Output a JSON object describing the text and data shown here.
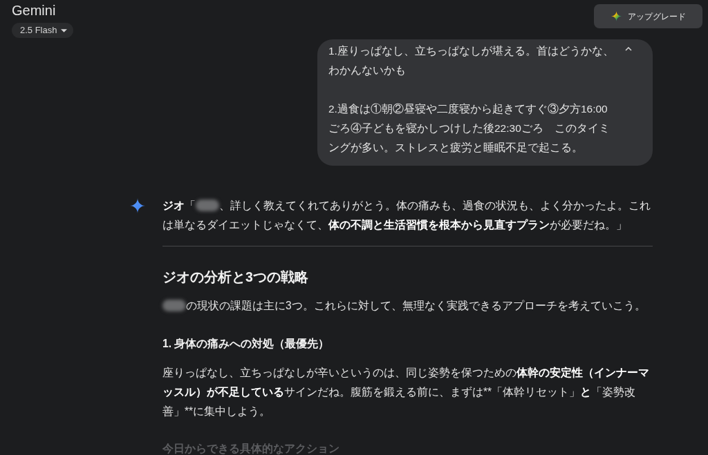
{
  "header": {
    "title": "Gemini",
    "model_picker": {
      "label": "2.5 Flash"
    },
    "upgrade_button": {
      "label": "アップグレード"
    }
  },
  "user_message": {
    "expanded": true,
    "paragraphs": [
      "1.座りっぱなし、立ちっぱなしが堪える。首はどうかな、わかんないかも",
      "2.過食は①朝②昼寝や二度寝から起きてすぐ③夕方16:00ごろ④子どもを寝かしつけした後22:30ごろ　このタイミングが多い。ストレスと疲労と睡眠不足で起こる。"
    ]
  },
  "response": {
    "blocks": [
      {
        "kind": "paragraph",
        "runs": [
          {
            "kind": "bold",
            "text": "ジオ"
          },
          {
            "kind": "text",
            "text": "「"
          },
          {
            "kind": "redacted"
          },
          {
            "kind": "text",
            "text": "、詳しく教えてくれてありがとう。体の痛みも、過食の状況も、よく分かったよ。これは単なるダイエットじゃなくて、"
          },
          {
            "kind": "bold",
            "text": "体の不調と生活習慣を根本から見直すプラン"
          },
          {
            "kind": "text",
            "text": "が必要だね。」"
          }
        ]
      },
      {
        "kind": "divider"
      },
      {
        "kind": "heading",
        "text": "ジオの分析と3つの戦略"
      },
      {
        "kind": "paragraph",
        "runs": [
          {
            "kind": "redacted"
          },
          {
            "kind": "text",
            "text": "の現状の課題は主に3つ。これらに対して、無理なく実践できるアプローチを考えていこう。"
          }
        ]
      },
      {
        "kind": "subheading",
        "faded": false,
        "text": "1. 身体の痛みへの対処（最優先）"
      },
      {
        "kind": "paragraph",
        "runs": [
          {
            "kind": "text",
            "text": "座りっぱなし、立ちっぱなしが辛いというのは、同じ姿勢を保つための"
          },
          {
            "kind": "bold",
            "text": "体幹の安定性（インナーマッスル）が不足している"
          },
          {
            "kind": "text",
            "text": "サインだね。腹筋を鍛える前に、まずは**「体幹リセット」"
          },
          {
            "kind": "bold",
            "text": "と"
          },
          {
            "kind": "text",
            "text": "「姿勢改善」**に集中しよう。"
          }
        ]
      },
      {
        "kind": "subheading",
        "faded": true,
        "text": "今日からできる具体的なアクション"
      }
    ]
  }
}
